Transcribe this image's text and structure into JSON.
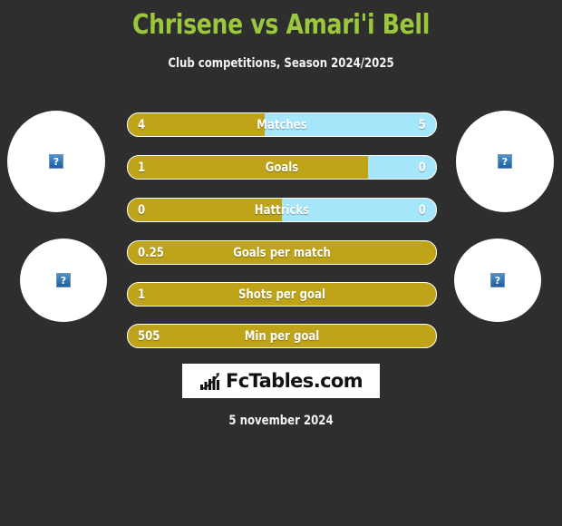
{
  "header": {
    "title": "Chrisene vs Amari'i Bell",
    "subtitle": "Club competitions, Season 2024/2025",
    "title_color": "#9ac73b"
  },
  "colors": {
    "background": "#2e2e2e",
    "home": "#bfa419",
    "away": "#a5e6fa",
    "text": "#ffffff"
  },
  "avatars": [
    {
      "name": "home-player-primary",
      "icon": "broken-image-icon"
    },
    {
      "name": "away-player-primary",
      "icon": "broken-image-icon"
    },
    {
      "name": "home-player-secondary",
      "icon": "broken-image-icon"
    },
    {
      "name": "away-player-secondary",
      "icon": "broken-image-icon"
    }
  ],
  "chart_data": {
    "type": "bar",
    "title": "Chrisene vs Amari'i Bell",
    "subtitle": "Club competitions, Season 2024/2025",
    "orientation": "horizontal-diverging",
    "series": [
      {
        "name": "Chrisene",
        "color": "#bfa419"
      },
      {
        "name": "Amari'i Bell",
        "color": "#a5e6fa"
      }
    ],
    "categories": [
      "Matches",
      "Goals",
      "Hattricks",
      "Goals per match",
      "Shots per goal",
      "Min per goal"
    ],
    "rows": [
      {
        "label": "Matches",
        "left": "4",
        "right": "5",
        "left_pct": 44.4,
        "split": true
      },
      {
        "label": "Goals",
        "left": "1",
        "right": "0",
        "left_pct": 78.0,
        "split": true
      },
      {
        "label": "Hattricks",
        "left": "0",
        "right": "0",
        "left_pct": 50.0,
        "split": true
      },
      {
        "label": "Goals per match",
        "left": "0.25",
        "right": "",
        "left_pct": 100,
        "split": false
      },
      {
        "label": "Shots per goal",
        "left": "1",
        "right": "",
        "left_pct": 100,
        "split": false
      },
      {
        "label": "Min per goal",
        "left": "505",
        "right": "",
        "left_pct": 100,
        "split": false
      }
    ]
  },
  "footer": {
    "logo_text": "FcTables.com",
    "logo_icon": "bar-chart-growth-icon",
    "date": "5 november 2024"
  }
}
